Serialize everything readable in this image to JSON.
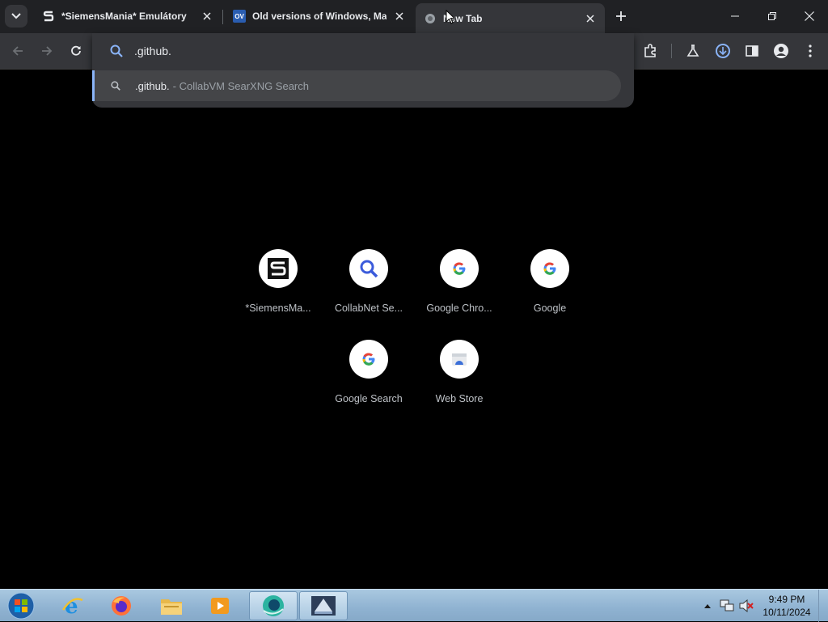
{
  "tabs": [
    {
      "title": "*SiemensMania* Emulátory",
      "favicon": "siemensmania-s-icon",
      "active": false
    },
    {
      "title": "Old versions of Windows, Mac",
      "favicon": "oldversion-ov-icon",
      "active": false
    },
    {
      "title": "New Tab",
      "favicon": "globe-icon",
      "active": true
    }
  ],
  "omnibox": {
    "value": ".github.",
    "suggestion": {
      "text": ".github.",
      "description": "- CollabVM SearXNG Search"
    }
  },
  "shortcuts": [
    {
      "label": "*SiemensMa...",
      "icon": "siemensmania-s-icon"
    },
    {
      "label": "CollabNet Se...",
      "icon": "magnifier-icon"
    },
    {
      "label": "Google Chro...",
      "icon": "google-g-icon"
    },
    {
      "label": "Google",
      "icon": "google-g-icon"
    },
    {
      "label": "Google Search",
      "icon": "google-g-icon"
    },
    {
      "label": "Web Store",
      "icon": "web-store-icon"
    }
  ],
  "taskbar": {
    "apps": [
      "internet-explorer-icon",
      "firefox-icon",
      "file-explorer-icon",
      "media-player-icon",
      "chrome-like-browser-icon",
      "collabvm-app-icon"
    ],
    "clock": {
      "time": "9:49 PM",
      "date": "10/11/2024"
    }
  },
  "colors": {
    "accent": "#8ab4f8",
    "tabstrip": "#202124",
    "toolbar": "#35363a",
    "page": "#000000"
  }
}
